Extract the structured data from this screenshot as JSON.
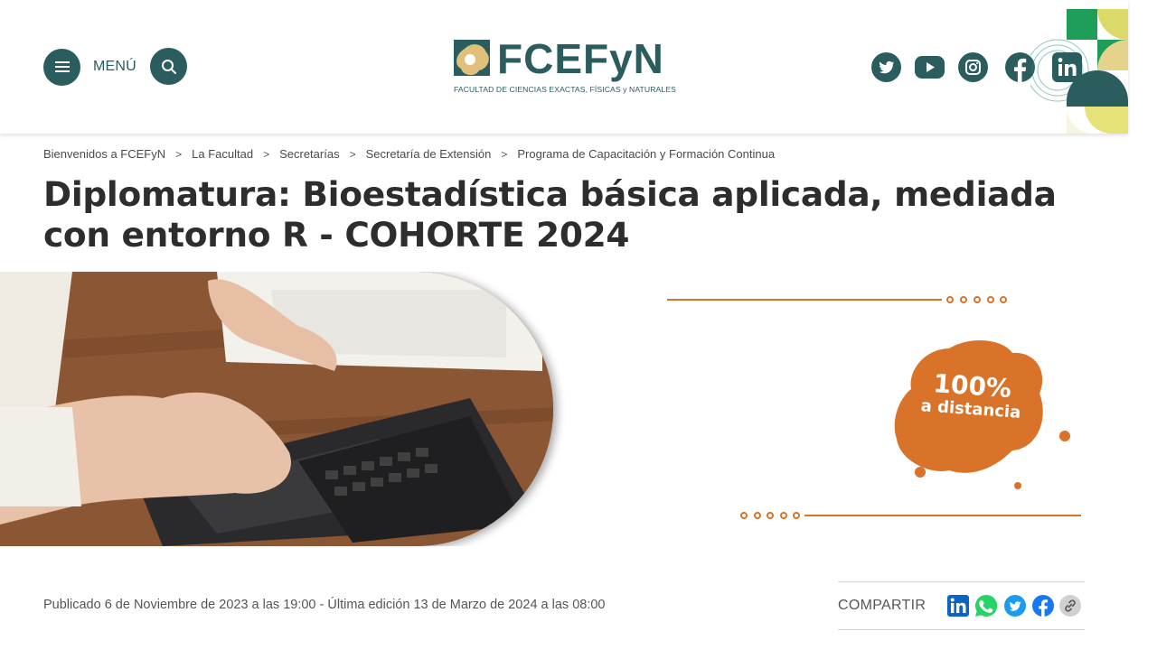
{
  "header": {
    "menu_label": "MENÚ",
    "logo_title": "FCEFyN",
    "logo_subtitle": "FACULTAD DE CIENCIAS EXACTAS, FÍSICAS y NATURALES",
    "socials": [
      "twitter-icon",
      "youtube-icon",
      "instagram-icon",
      "facebook-icon",
      "linkedin-icon"
    ],
    "brand_color": "#2b5d5e"
  },
  "breadcrumb": {
    "items": [
      "Bienvenidos a FCEFyN",
      "La Facultad",
      "Secretarías",
      "Secretaría de Extensión",
      "Programa de Capacitación y Formación Continua"
    ],
    "separator": ">"
  },
  "article": {
    "title": "Diplomatura: Bioestadística básica aplicada, mediada con entorno R - COHORTE 2024",
    "published": "Publicado 6 de Noviembre de 2023 a las 19:00 - Última edición 13 de Marzo de 2024 a las 08:00"
  },
  "banner": {
    "badge_line1": "100%",
    "badge_line2": "a distancia",
    "accent_color": "#d9732a"
  },
  "share": {
    "label": "COMPARTIR",
    "icons": [
      "linkedin-icon",
      "whatsapp-icon",
      "twitter-icon",
      "facebook-icon",
      "link-icon"
    ]
  }
}
